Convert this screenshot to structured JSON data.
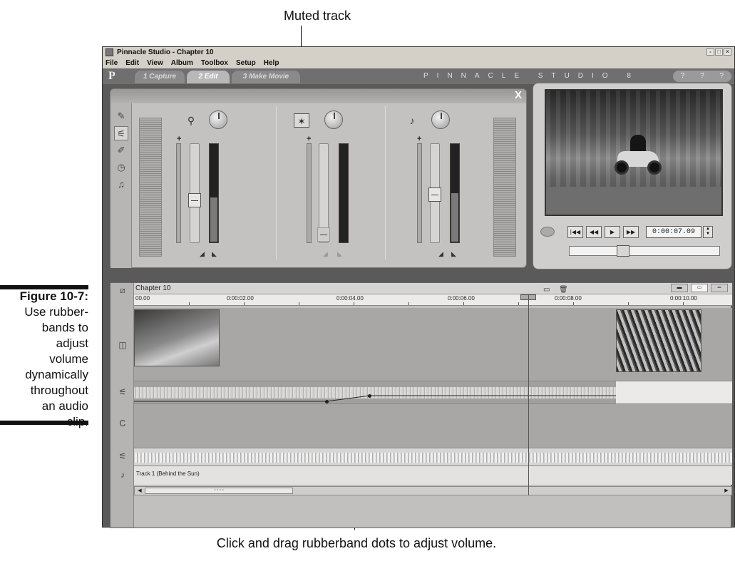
{
  "callouts": {
    "top": "Muted track",
    "bottom": "Click and drag rubberband dots to adjust volume."
  },
  "caption": {
    "label": "Figure 10-7:",
    "text_lines": [
      "Use rubber-",
      "bands to",
      "adjust",
      "volume",
      "dynamically",
      "throughout",
      "an audio",
      "clip."
    ]
  },
  "window": {
    "title": "Pinnacle Studio - Chapter 10",
    "controls": [
      "-",
      "□",
      "×"
    ],
    "menu": [
      "File",
      "Edit",
      "View",
      "Album",
      "Toolbox",
      "Setup",
      "Help"
    ],
    "logo": "P",
    "tabs": [
      "1 Capture",
      "2 Edit",
      "3 Make Movie"
    ],
    "active_tab": "2 Edit",
    "brand": "PINNACLE STUDIO 8",
    "help_icons": [
      "?",
      "?",
      "?"
    ]
  },
  "mixer": {
    "close": "X",
    "tools": [
      {
        "name": "video-toolbox",
        "glyph": "✎"
      },
      {
        "name": "audio-volume",
        "glyph": "⚟"
      },
      {
        "name": "voice-over",
        "glyph": "✐"
      },
      {
        "name": "sound-effect",
        "glyph": "◷"
      },
      {
        "name": "background-music",
        "glyph": "♫"
      }
    ],
    "channels": [
      {
        "icon": "video-audio-icon",
        "glyph": "⚲",
        "muted": false,
        "level": 0.5
      },
      {
        "icon": "sound-effects-muted-icon",
        "glyph": "✶",
        "muted": true,
        "level": 0.05
      },
      {
        "icon": "music-icon",
        "glyph": "♪",
        "muted": false,
        "level": 0.6
      }
    ]
  },
  "player": {
    "buttons": [
      "|◀◀",
      "◀◀",
      "▶",
      "▶▶"
    ],
    "timecode": "0:00:07.09",
    "position": 0.33
  },
  "timeline": {
    "title": "Chapter 10",
    "ruler": [
      "00.00",
      "0:00:02.00",
      "0:00:04.00",
      "0:00:06.00",
      "0:00:08.00",
      "0:00:10.00"
    ],
    "music_track": "Track 1 (Behind the Sun)",
    "scroll_grip": "∘∘∘∘",
    "view_buttons": [
      "▬",
      "▭",
      "═"
    ]
  }
}
